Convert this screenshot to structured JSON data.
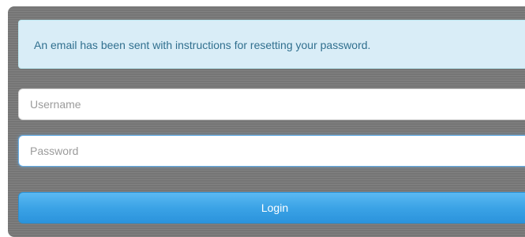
{
  "alert": {
    "message": "An email has been sent with instructions for resetting your password."
  },
  "form": {
    "username": {
      "value": "",
      "placeholder": "Username"
    },
    "password": {
      "value": "",
      "placeholder": "Password"
    },
    "login_label": "Login"
  },
  "colors": {
    "panel_background": "#7a7a7a",
    "alert_background": "#d9edf7",
    "alert_text": "#31708f",
    "button_background": "#3ba3e6",
    "focus_border": "#66afe9"
  }
}
